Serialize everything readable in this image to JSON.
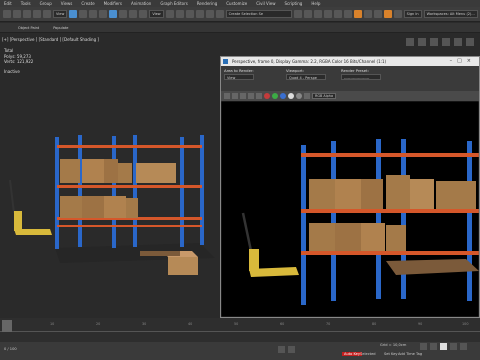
{
  "menubar": {
    "items": [
      "Edit",
      "Tools",
      "Group",
      "Views",
      "Create",
      "Modifiers",
      "Animation",
      "Graph Editors",
      "Rendering",
      "Customize",
      "Civil View",
      "Scripting",
      "Help"
    ]
  },
  "toolbar": {
    "filter_value": "View",
    "selection_set": "Create Selection Se",
    "workspace": "Workspaces: Alt Menu (2)...",
    "user": "Sign In"
  },
  "ribbon": {
    "tabs": [
      "Object Paint",
      "Populate"
    ]
  },
  "viewport": {
    "label": "[+] [Perspective ] [Standard ] [Default Shading ]",
    "stats": {
      "total_label": "Total",
      "polys_label": "Polys:",
      "polys_value": "59,273",
      "verts_label": "Verts:",
      "verts_value": "121,922",
      "fps_label": "Inactive"
    }
  },
  "frame_window": {
    "title": "Perspective, frame 0, Display Gamma: 2.2, RGBA Color 16 Bits/Channel (1:1)",
    "area_label": "Area to Render:",
    "area_value": "View",
    "viewport_label": "Viewport:",
    "viewport_value": "Quad 4 - Perspe",
    "preset_label": "Render Preset:",
    "preset_value": "--------------------",
    "channel_value": "RGB Alpha"
  },
  "timeline": {
    "ticks": [
      "0",
      "10",
      "20",
      "30",
      "40",
      "50",
      "60",
      "70",
      "80",
      "90",
      "100"
    ]
  },
  "statusbar": {
    "frame_value": "0 / 100",
    "grid_label": "Grid = 10,0cm",
    "autokey_label": "Auto Key",
    "selected_label": "Selected",
    "setkey_label": "Set Key",
    "add_time_tag": "Add Time Tag"
  },
  "colors": {
    "rack_upright": "#2a67c9",
    "rack_beam": "#d5572a",
    "box": "#a47a49",
    "pallet_jack": "#d8b93b",
    "autokey_red": "#c21e1e"
  }
}
